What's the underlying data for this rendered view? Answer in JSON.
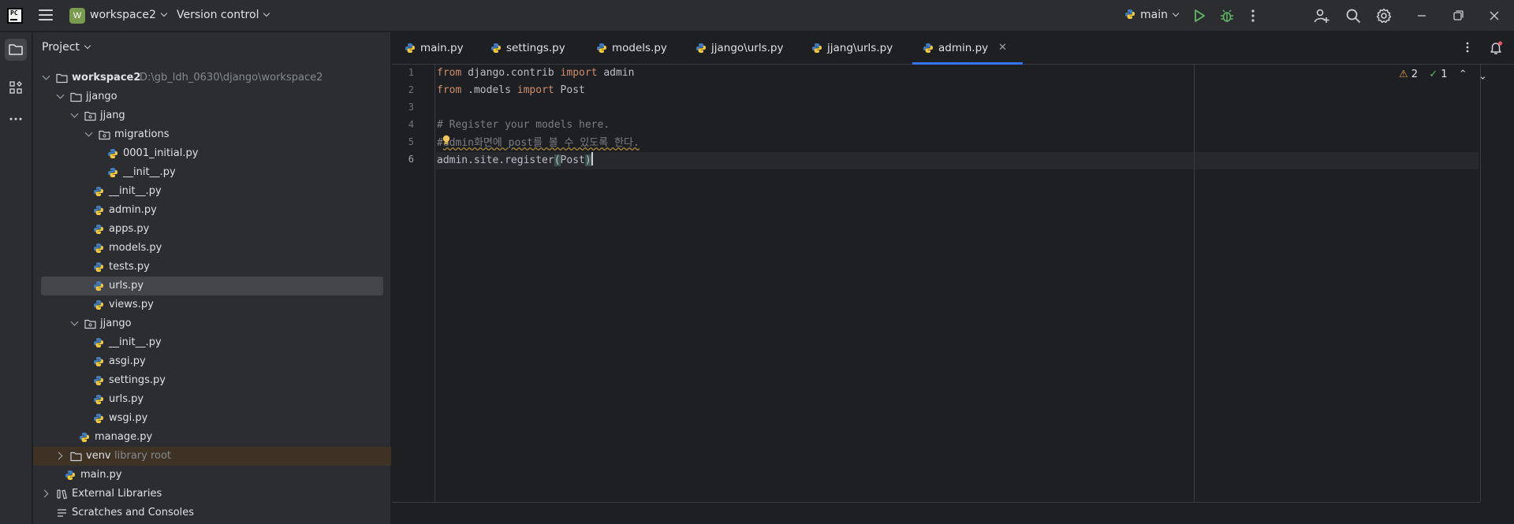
{
  "titlebar": {
    "logo_text": "PC",
    "workspace_initial": "W",
    "workspace_name": "workspace2",
    "version_control": "Version control",
    "branch": "main",
    "icons": [
      "hamburger-menu-icon",
      "play-icon",
      "bug-icon",
      "more-vertical-icon",
      "add-user-icon",
      "search-icon",
      "gear-icon",
      "minimize-icon",
      "maximize-icon",
      "close-icon"
    ],
    "colors": {
      "run": "#5fb865",
      "workspace_badge": "#7a9a4e"
    }
  },
  "toolstrip": {
    "icons": [
      "folder-icon",
      "structure-icon",
      "more-horizontal-icon"
    ]
  },
  "project": {
    "title": "Project",
    "root_path": "D:\\gb_ldh_0630\\django\\workspace2",
    "venv_hint": "library root",
    "tree": [
      {
        "label": "workspace2"
      },
      {
        "label": "jjango"
      },
      {
        "label": "jjang"
      },
      {
        "label": "migrations"
      },
      {
        "label": "0001_initial.py"
      },
      {
        "label": "__init__.py"
      },
      {
        "label": "__init__.py"
      },
      {
        "label": "admin.py"
      },
      {
        "label": "apps.py"
      },
      {
        "label": "models.py"
      },
      {
        "label": "tests.py"
      },
      {
        "label": "urls.py"
      },
      {
        "label": "views.py"
      },
      {
        "label": "jjango"
      },
      {
        "label": "__init__.py"
      },
      {
        "label": "asgi.py"
      },
      {
        "label": "settings.py"
      },
      {
        "label": "urls.py"
      },
      {
        "label": "wsgi.py"
      },
      {
        "label": "manage.py"
      },
      {
        "label": "venv"
      },
      {
        "label": "main.py"
      },
      {
        "label": "External Libraries"
      },
      {
        "label": "Scratches and Consoles"
      }
    ]
  },
  "tabs": [
    {
      "label": "main.py"
    },
    {
      "label": "settings.py"
    },
    {
      "label": "models.py"
    },
    {
      "label": "jjango\\urls.py"
    },
    {
      "label": "jjang\\urls.py"
    },
    {
      "label": "admin.py",
      "active": true
    }
  ],
  "editor": {
    "line_numbers": [
      "1",
      "2",
      "3",
      "4",
      "5",
      "6"
    ],
    "lines": {
      "l1": {
        "kw1": "from",
        "mod": " django.contrib ",
        "kw2": "import",
        "name": " admin"
      },
      "l2": {
        "kw1": "from",
        "mod": " .models ",
        "kw2": "import",
        "name": " Post"
      },
      "l4": "# Register your models here.",
      "l5_hash": "#",
      "l5_rest": "admin화면에 post를 볼 수 있도록 한다.",
      "l6_pre": "admin.site.register",
      "l6_open": "(",
      "l6_arg": "Post",
      "l6_close": ")"
    },
    "inspections": {
      "warnings": "2",
      "ok": "1"
    }
  }
}
